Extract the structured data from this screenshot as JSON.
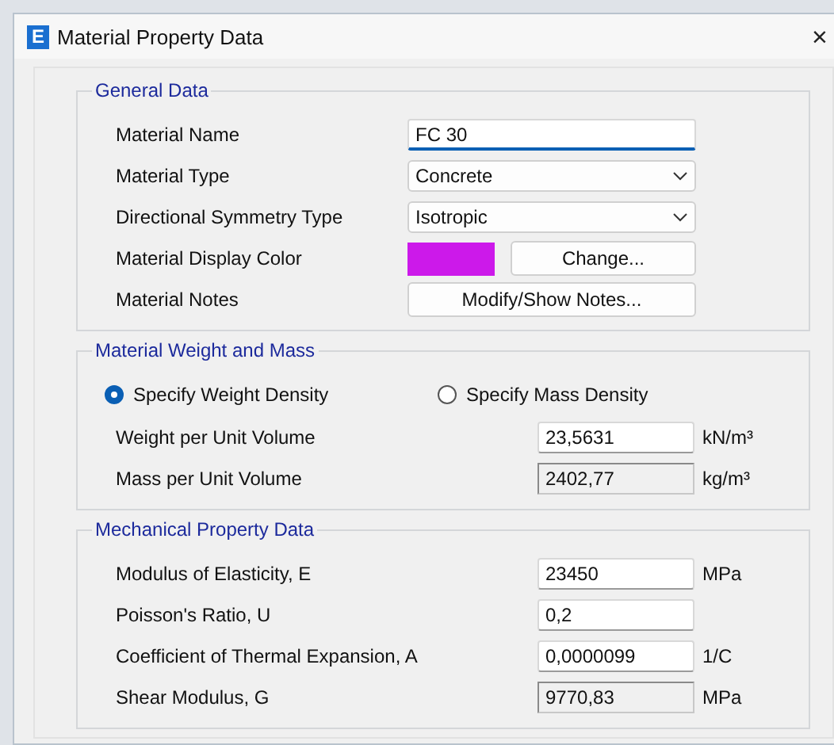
{
  "window": {
    "title": "Material Property Data",
    "icon": "E",
    "close": "×"
  },
  "groups": [
    {
      "title": "General Data",
      "rows": [
        {
          "label": "Material Name",
          "kind": "text",
          "value": "FC 30",
          "focused": true
        },
        {
          "label": "Material Type",
          "kind": "dropdown",
          "value": "Concrete"
        },
        {
          "label": "Directional Symmetry Type",
          "kind": "dropdown",
          "value": "Isotropic"
        },
        {
          "label": "Material Display Color",
          "kind": "color",
          "color": "#cc19ea",
          "button": "Change..."
        },
        {
          "label": "Material Notes",
          "kind": "button",
          "button": "Modify/Show Notes..."
        }
      ]
    },
    {
      "title": "Material Weight and Mass",
      "options": [
        {
          "label": "Specify Weight Density",
          "selected": true
        },
        {
          "label": "Specify Mass Density",
          "selected": false
        }
      ],
      "rows": [
        {
          "label": "Weight per Unit Volume",
          "kind": "text",
          "value": "23,5631",
          "unit": "kN/m³",
          "focused": false
        },
        {
          "label": "Mass per Unit Volume",
          "kind": "readonly",
          "value": "2402,77",
          "unit": "kg/m³"
        }
      ]
    },
    {
      "title": "Mechanical Property Data",
      "rows": [
        {
          "label": "Modulus of Elasticity,  E",
          "kind": "text",
          "value": "23450",
          "unit": "MPa",
          "focused": false
        },
        {
          "label": "Poisson's Ratio,  U",
          "kind": "text",
          "value": "0,2",
          "focused": false
        },
        {
          "label": "Coefficient of Thermal Expansion,  A",
          "kind": "text",
          "value": "0,0000099",
          "unit": "1/C",
          "focused": false
        },
        {
          "label": "Shear Modulus,  G",
          "kind": "readonly",
          "value": "9770,83",
          "unit": "MPa"
        }
      ]
    }
  ]
}
